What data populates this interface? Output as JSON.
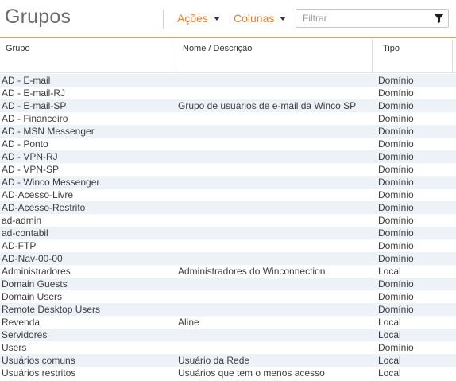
{
  "header": {
    "title": "Grupos",
    "actions_label": "Ações",
    "columns_label": "Colunas",
    "filter_placeholder": "Filtrar",
    "filter_icon": "funnel-icon",
    "accent_color": "#ee7d2a"
  },
  "table": {
    "columns": {
      "group": "Grupo",
      "name": "Nome / Descrição",
      "type": "Tipo"
    },
    "rows": [
      {
        "group": "AD - E-mail",
        "name": "",
        "type": "Domínio"
      },
      {
        "group": "AD - E-mail-RJ",
        "name": "",
        "type": "Domínio"
      },
      {
        "group": "AD - E-mail-SP",
        "name": "Grupo de usuarios de e-mail da Winco SP",
        "type": "Domínio"
      },
      {
        "group": "AD - Financeiro",
        "name": "",
        "type": "Domínio"
      },
      {
        "group": "AD - MSN Messenger",
        "name": "",
        "type": "Domínio"
      },
      {
        "group": "AD - Ponto",
        "name": "",
        "type": "Domínio"
      },
      {
        "group": "AD - VPN-RJ",
        "name": "",
        "type": "Domínio"
      },
      {
        "group": "AD - VPN-SP",
        "name": "",
        "type": "Domínio"
      },
      {
        "group": "AD - Winco Messenger",
        "name": "",
        "type": "Domínio"
      },
      {
        "group": "AD-Acesso-Livre",
        "name": "",
        "type": "Domínio"
      },
      {
        "group": "AD-Acesso-Restrito",
        "name": "",
        "type": "Domínio"
      },
      {
        "group": "ad-admin",
        "name": "",
        "type": "Domínio"
      },
      {
        "group": "ad-contabil",
        "name": "",
        "type": "Domínio"
      },
      {
        "group": "AD-FTP",
        "name": "",
        "type": "Domínio"
      },
      {
        "group": "AD-Nav-00-00",
        "name": "",
        "type": "Domínio"
      },
      {
        "group": "Administradores",
        "name": "Administradores do Winconnection",
        "type": "Local"
      },
      {
        "group": "Domain Guests",
        "name": "",
        "type": "Domínio"
      },
      {
        "group": "Domain Users",
        "name": "",
        "type": "Domínio"
      },
      {
        "group": "Remote Desktop Users",
        "name": "",
        "type": "Domínio"
      },
      {
        "group": "Revenda",
        "name": "Aline",
        "type": "Local"
      },
      {
        "group": "Servidores",
        "name": "",
        "type": "Local"
      },
      {
        "group": "Users",
        "name": "",
        "type": "Domínio"
      },
      {
        "group": "Usuários comuns",
        "name": "Usuário da Rede",
        "type": "Local"
      },
      {
        "group": "Usuários restritos",
        "name": "Usuários que tem o menos acesso",
        "type": "Local"
      }
    ]
  }
}
